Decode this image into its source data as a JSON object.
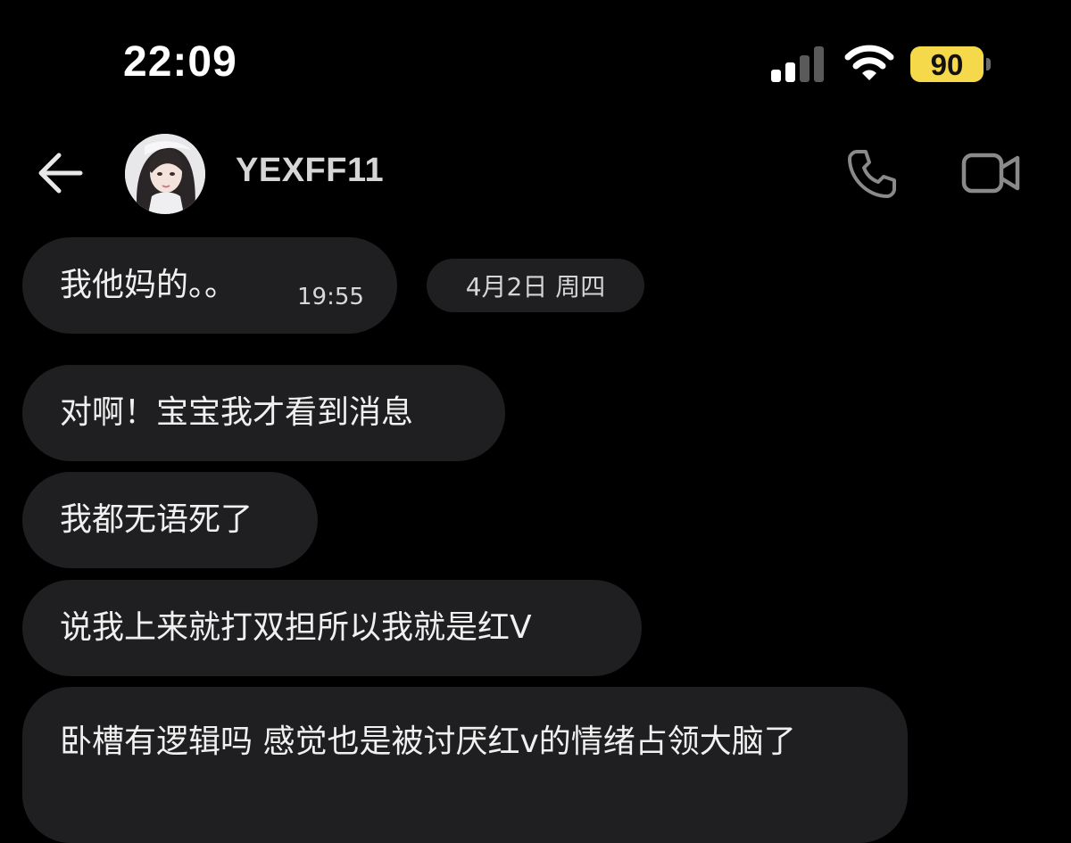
{
  "status_bar": {
    "time": "22:09",
    "battery_level": "90",
    "signal_bars_active": 2,
    "signal_bars_total": 4,
    "icons": [
      "signal-icon",
      "wifi-icon",
      "battery-icon"
    ],
    "battery_color": "#f5d94a"
  },
  "header": {
    "contact_name": "YEXFF11",
    "icons": [
      "back-arrow-icon",
      "avatar",
      "phone-icon",
      "video-camera-icon"
    ]
  },
  "messages": [
    {
      "text": "我他妈的。。",
      "time": "19:55"
    },
    {
      "text": "对啊！宝宝我才看到消息"
    },
    {
      "text": "我都无语死了"
    },
    {
      "text": "说我上来就打双担所以我就是红V"
    },
    {
      "text": "卧槽有逻辑吗 感觉也是被讨厌红v的情绪占领大脑了"
    }
  ],
  "date_separator": "4月2日 周四",
  "colors": {
    "background": "#000000",
    "bubble": "#1f1f21",
    "text": "#f0f0f0"
  }
}
